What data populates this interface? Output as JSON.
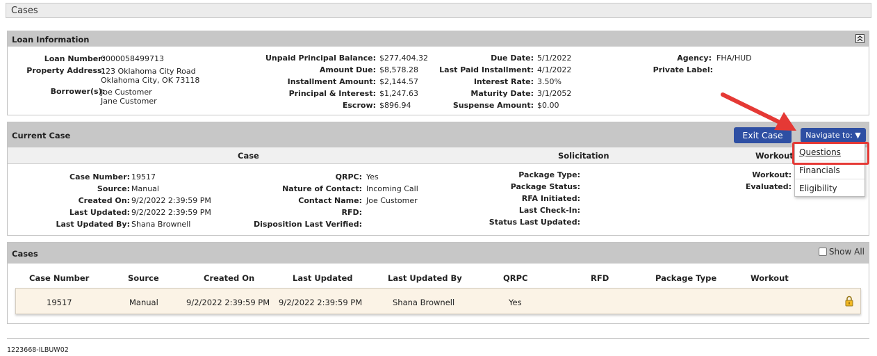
{
  "page": {
    "title": "Cases"
  },
  "loan_info": {
    "title": "Loan Information",
    "collapse_icon": "double-chevron-up-icon",
    "col1": {
      "loan_number_label": "Loan Number:",
      "loan_number": "0000058499713",
      "property_address_label": "Property Address:",
      "address_line1": "123 Oklahoma City Road",
      "address_line2": "Oklahoma City, OK 73118",
      "borrowers_label": "Borrower(s):",
      "borrower1": "Joe Customer",
      "borrower2": "Jane Customer"
    },
    "col2": {
      "upb_label": "Unpaid Principal Balance:",
      "upb": "$277,404.32",
      "amount_due_label": "Amount Due:",
      "amount_due": "$8,578.28",
      "installment_label": "Installment Amount:",
      "installment": "$2,144.57",
      "pi_label": "Principal & Interest:",
      "pi": "$1,247.63",
      "escrow_label": "Escrow:",
      "escrow": "$896.94"
    },
    "col3": {
      "due_date_label": "Due Date:",
      "due_date": "5/1/2022",
      "last_paid_label": "Last Paid Installment:",
      "last_paid": "4/1/2022",
      "interest_label": "Interest Rate:",
      "interest": "3.50%",
      "maturity_label": "Maturity Date:",
      "maturity": "3/1/2052",
      "suspense_label": "Suspense Amount:",
      "suspense": "$0.00"
    },
    "col4": {
      "agency_label": "Agency:",
      "agency": "FHA/HUD",
      "private_label_label": "Private Label:"
    }
  },
  "current_case": {
    "title": "Current Case",
    "exit_button": "Exit Case",
    "navigate_button": "Navigate to: ▼",
    "subheads": {
      "case": "Case",
      "solicitation": "Solicitation",
      "workout": "Workout"
    },
    "case_col1": {
      "case_number_label": "Case Number:",
      "case_number": "19517",
      "source_label": "Source:",
      "source": "Manual",
      "created_label": "Created On:",
      "created": "9/2/2022 2:39:59 PM",
      "updated_label": "Last Updated:",
      "updated": "9/2/2022 2:39:59 PM",
      "updated_by_label": "Last Updated By:",
      "updated_by": "Shana Brownell"
    },
    "case_col2": {
      "qrpc_label": "QRPC:",
      "qrpc": "Yes",
      "nature_label": "Nature of Contact:",
      "nature": "Incoming Call",
      "contact_label": "Contact Name:",
      "contact": "Joe Customer",
      "rfd_label": "RFD:",
      "disposition_label": "Disposition Last Verified:"
    },
    "solicitation": {
      "package_type_label": "Package Type:",
      "package_status_label": "Package Status:",
      "rfa_label": "RFA Initiated:",
      "checkin_label": "Last Check-In:",
      "status_updated_label": "Status Last Updated:"
    },
    "workout": {
      "workout_label": "Workout:",
      "evaluated_label": "Evaluated:"
    }
  },
  "navigate_menu": {
    "items": [
      "Questions",
      "Financials",
      "Eligibility"
    ]
  },
  "cases": {
    "title": "Cases",
    "show_all": "Show All",
    "columns": [
      "Case Number",
      "Source",
      "Created On",
      "Last Updated",
      "Last Updated By",
      "QRPC",
      "RFD",
      "Package Type",
      "Workout"
    ],
    "rows": [
      {
        "case_number": "19517",
        "source": "Manual",
        "created_on": "9/2/2022 2:39:59 PM",
        "last_updated": "9/2/2022 2:39:59 PM",
        "last_updated_by": "Shana Brownell",
        "qrpc": "Yes",
        "rfd": "",
        "package_type": "",
        "workout": "",
        "icon": "lock-icon"
      }
    ]
  },
  "footer": {
    "text": "1223668-ILBUW02"
  },
  "colors": {
    "button_blue": "#2e4fa3",
    "header_gray": "#c7c7c7",
    "row_bg": "#fbf3e6",
    "highlight_red": "#e53935"
  }
}
